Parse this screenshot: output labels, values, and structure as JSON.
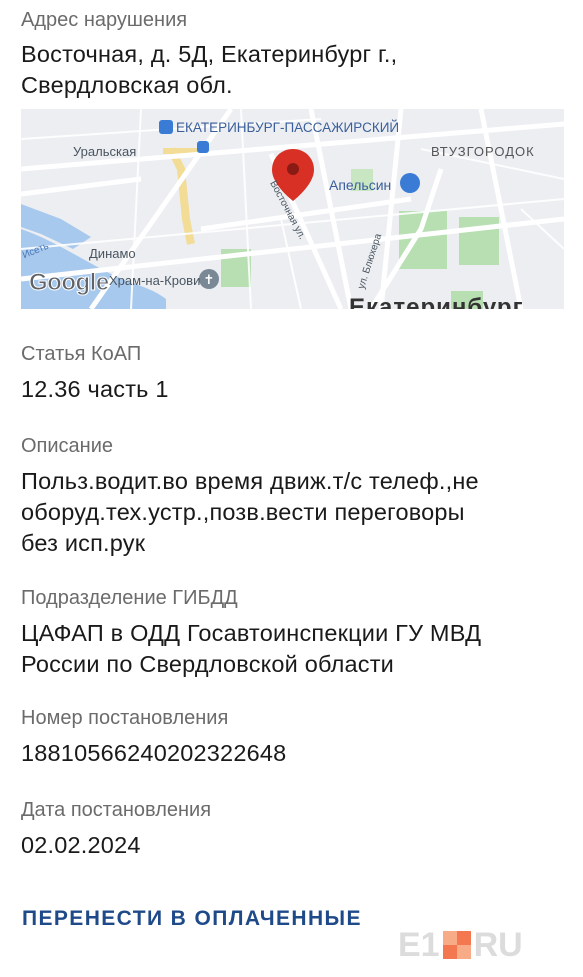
{
  "address": {
    "label": "Адрес нарушения",
    "line1": "Восточная, д. 5Д, Екатеринбург г.,",
    "line2": "Свердловская обл."
  },
  "map": {
    "labels": {
      "station": "ЕКАТЕРИНБУРГ-ПАССАЖИРСКИЙ",
      "uralskaya": "Уральская",
      "vtuzgorodok": "ВТУЗГОРОДОК",
      "apelsin": "Апельсин",
      "vostochnaya": "Восточная ул.",
      "blyukhera": "ул. Блюхера",
      "iset": "Исеть",
      "dinamo": "Динамо",
      "church": "Храм-на-Крови",
      "city": "Екатеринбург",
      "logo": "Google"
    },
    "colors": {
      "pin": "#d93025",
      "water": "#a8c9ee",
      "park": "#b7dfb1",
      "transit": "#3a7bd5"
    }
  },
  "article": {
    "label": "Статья КоАП",
    "value": "12.36 часть 1"
  },
  "description": {
    "label": "Описание",
    "line1": "Польз.водит.во время движ.т/с телеф.,не",
    "line2": "оборуд.тех.устр.,позв.вести переговоры",
    "line3": "без исп.рук"
  },
  "unit": {
    "label": "Подразделение ГИБДД",
    "line1": "ЦАФАП в ОДД Госавтоинспекции ГУ МВД",
    "line2": "России по Свердловской области"
  },
  "resolution_number": {
    "label": "Номер постановления",
    "value": "18810566240202322648"
  },
  "resolution_date": {
    "label": "Дата постановления",
    "value": "02.02.2024"
  },
  "action": {
    "label": "ПЕРЕНЕСТИ В ОПЛАЧЕННЫЕ"
  },
  "watermark": {
    "left": "E1",
    "right": "RU"
  }
}
